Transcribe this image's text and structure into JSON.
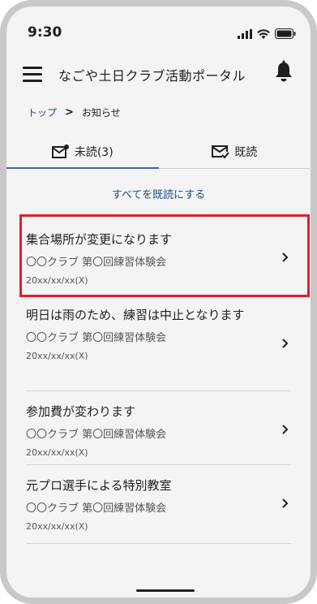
{
  "status_bar": {
    "time": "9:30"
  },
  "app_bar": {
    "title": "なごや土日クラブ活動ポータル",
    "menu_icon": "hamburger-menu-icon",
    "bell_icon": "bell-icon"
  },
  "breadcrumb": {
    "home": "トップ",
    "separator": ">",
    "current": "お知らせ"
  },
  "tabs": {
    "unread_label": "未読(3)",
    "read_label": "既読",
    "active": "unread"
  },
  "mark_all_read": "すべてを既読にする",
  "notices": [
    {
      "title": "集合場所が変更になります",
      "subtitle": "〇〇クラブ 第〇回練習体験会",
      "date": "20xx/xx/xx(X)"
    },
    {
      "title": "明日は雨のため、練習は中止となります",
      "subtitle": "〇〇クラブ 第〇回練習体験会",
      "date": "20xx/xx/xx(X)"
    },
    {
      "title": "参加費が変わります",
      "subtitle": "〇〇クラブ 第〇回練習体験会",
      "date": "20xx/xx/xx(X)"
    },
    {
      "title": "元プロ選手による特別教室",
      "subtitle": "〇〇クラブ 第〇回練習体験会",
      "date": "20xx/xx/xx(X)"
    }
  ],
  "colors": {
    "accent": "#3b6aa5",
    "link": "#1f4d80",
    "highlight": "#e01e2b"
  }
}
